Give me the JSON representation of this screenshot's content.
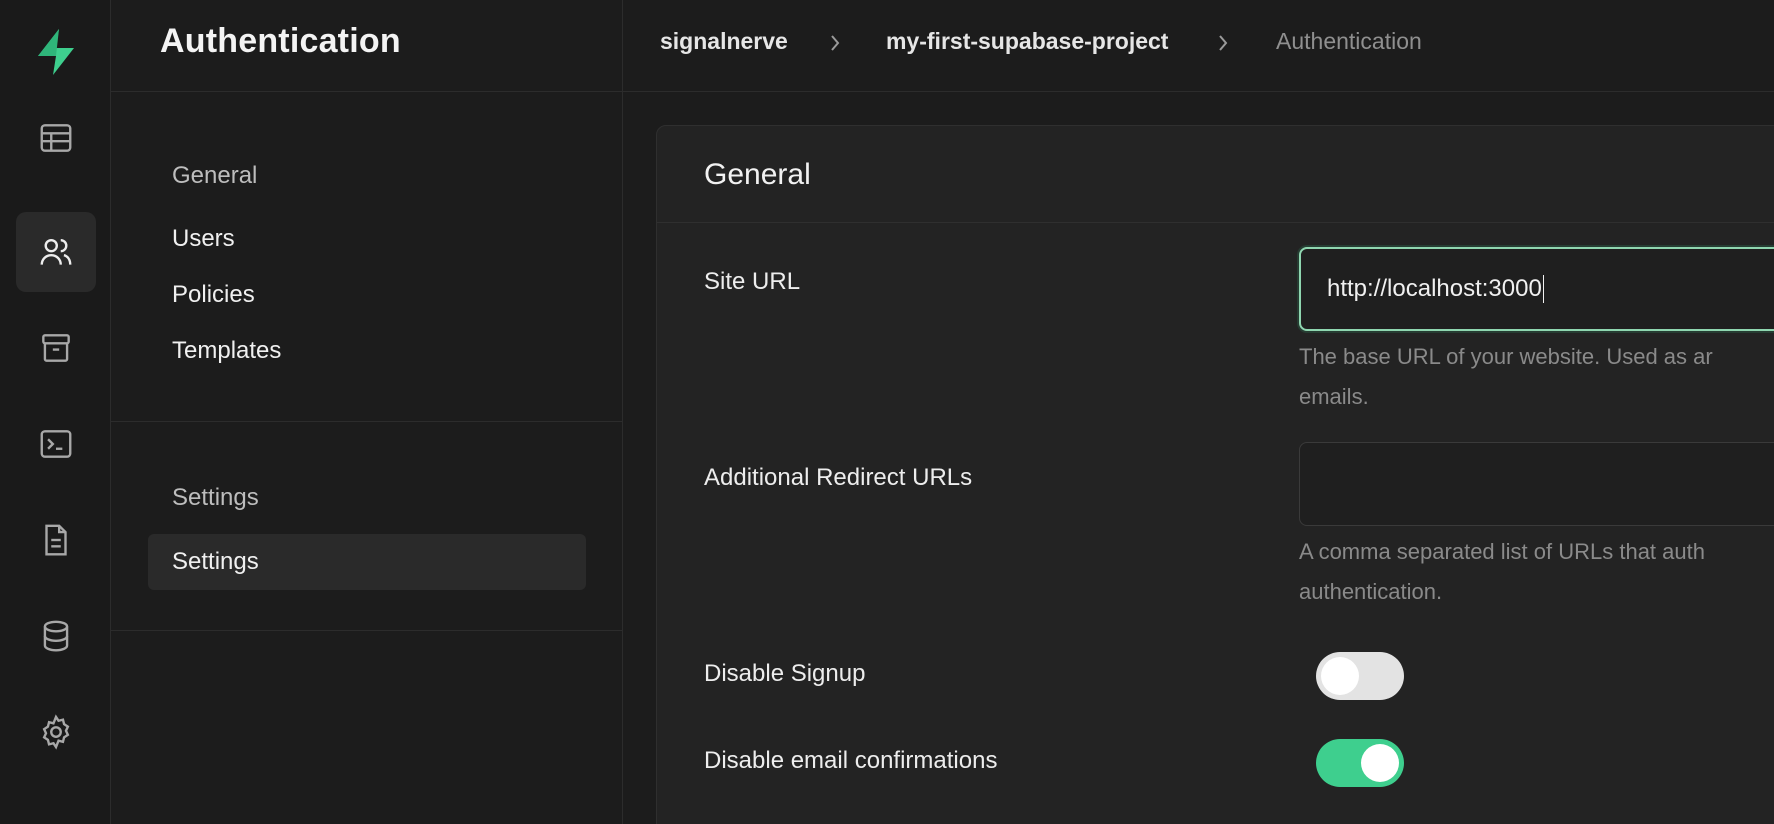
{
  "rail": {
    "items": [
      {
        "icon": "table-icon",
        "active": false
      },
      {
        "icon": "users-icon",
        "active": true
      },
      {
        "icon": "archive-icon",
        "active": false
      },
      {
        "icon": "terminal-icon",
        "active": false
      },
      {
        "icon": "document-icon",
        "active": false
      },
      {
        "icon": "database-icon",
        "active": false
      },
      {
        "icon": "gear-icon",
        "active": false
      }
    ],
    "brand_color": "#3ecf8e"
  },
  "sidebar": {
    "title": "Authentication",
    "general_label": "General",
    "general_items": [
      "Users",
      "Policies",
      "Templates"
    ],
    "settings_label": "Settings",
    "settings_items": [
      "Settings"
    ]
  },
  "breadcrumb": {
    "org": "signalnerve",
    "project": "my-first-supabase-project",
    "current": "Authentication"
  },
  "card": {
    "title": "General",
    "site_url": {
      "label": "Site URL",
      "value": "http://localhost:3000",
      "help_line1": "The base URL of your website. Used as ar",
      "help_line2": "emails."
    },
    "redirect_urls": {
      "label": "Additional Redirect URLs",
      "value": "",
      "help_line1": "A comma separated list of URLs that auth",
      "help_line2": "authentication."
    },
    "disable_signup": {
      "label": "Disable Signup",
      "enabled": false
    },
    "disable_email_confirmations": {
      "label": "Disable email confirmations",
      "enabled": true
    }
  }
}
